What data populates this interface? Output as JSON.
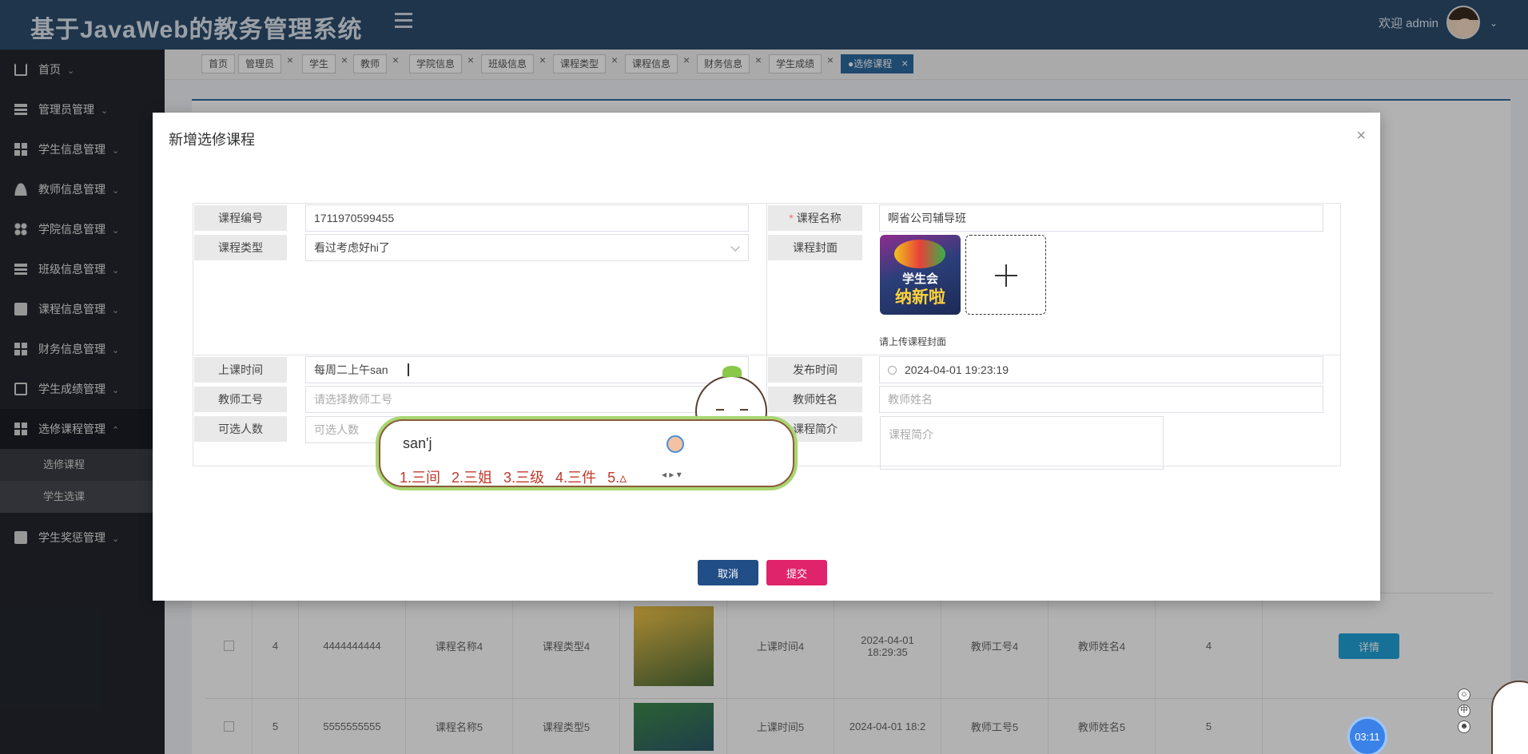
{
  "header": {
    "title": "基于JavaWeb的教务管理系统",
    "welcome": "欢迎 admin"
  },
  "sidebar": {
    "items": [
      {
        "label": "首页",
        "icon": "home-icon"
      },
      {
        "label": "管理员管理",
        "icon": "table-icon"
      },
      {
        "label": "学生信息管理",
        "icon": "grid-icon"
      },
      {
        "label": "教师信息管理",
        "icon": "user-icon"
      },
      {
        "label": "学院信息管理",
        "icon": "circles-icon"
      },
      {
        "label": "班级信息管理",
        "icon": "bars-icon"
      },
      {
        "label": "课程信息管理",
        "icon": "book-icon"
      },
      {
        "label": "财务信息管理",
        "icon": "grid-icon"
      },
      {
        "label": "学生成绩管理",
        "icon": "chart-icon"
      },
      {
        "label": "选修课程管理",
        "icon": "grid-icon"
      },
      {
        "label": "学生奖惩管理",
        "icon": "book-icon"
      }
    ],
    "sub_items": [
      "选修课程",
      "学生选课"
    ]
  },
  "tabs": [
    "首页",
    "管理员",
    "学生",
    "教师",
    "学院信息",
    "班级信息",
    "课程类型",
    "课程信息",
    "财务信息",
    "学生成绩",
    "●选修课程"
  ],
  "background_table": {
    "rows": [
      {
        "index": "4",
        "code": "4444444444",
        "name": "课程名称4",
        "type": "课程类型4",
        "time": "上课时间4",
        "publish": "2024-04-01 18:29:35",
        "teacher_no": "教师工号4",
        "teacher_name": "教师姓名4",
        "count": "4",
        "action": "详情"
      },
      {
        "index": "5",
        "code": "5555555555",
        "name": "课程名称5",
        "type": "课程类型5",
        "time": "上课时间5",
        "publish": "2024-04-01 18:2",
        "teacher_no": "教师工号5",
        "teacher_name": "教师姓名5",
        "count": "5",
        "action": "详情"
      }
    ]
  },
  "modal": {
    "title": "新增选修课程",
    "fields": {
      "course_code": {
        "label": "课程编号",
        "value": "1711970599455"
      },
      "course_name": {
        "label": "课程名称",
        "value": "啊省公司辅导班"
      },
      "course_type": {
        "label": "课程类型",
        "value": "看过考虑好hi了"
      },
      "course_cover": {
        "label": "课程封面",
        "hint": "请上传课程封面",
        "cover_text_1": "学生会",
        "cover_text_2": "纳新啦"
      },
      "class_time": {
        "label": "上课时间",
        "value": "每周二上午san"
      },
      "publish_time": {
        "label": "发布时间",
        "value": "2024-04-01 19:23:19"
      },
      "teacher_no": {
        "label": "教师工号",
        "placeholder": "请选择教师工号"
      },
      "teacher_name": {
        "label": "教师姓名",
        "placeholder": "教师姓名"
      },
      "capacity": {
        "label": "可选人数",
        "placeholder": "可选人数"
      },
      "intro": {
        "label": "课程简介",
        "placeholder": "课程简介"
      }
    },
    "buttons": {
      "cancel": "取消",
      "submit": "提交"
    }
  },
  "ime": {
    "input": "san'j",
    "candidates": [
      "1.三间",
      "2.三姐",
      "3.三级",
      "4.三件",
      "5.▵"
    ]
  },
  "timer": "03:11"
}
